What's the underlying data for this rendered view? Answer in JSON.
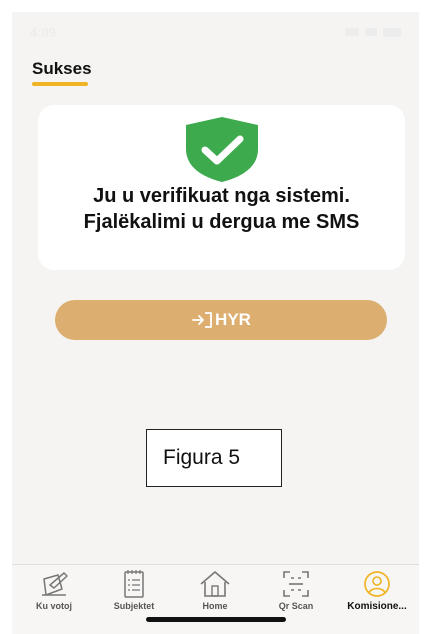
{
  "status_bar": {
    "time": "4:09"
  },
  "header": {
    "title": "Sukses"
  },
  "card": {
    "message": "Ju u verifikuat nga sistemi. Fjalëkalimi u dergua me SMS"
  },
  "login_button": {
    "label": "HYR"
  },
  "figure_caption": "Figura 5",
  "tabbar": {
    "items": [
      {
        "label": "Ku votoj",
        "icon": "vote-icon"
      },
      {
        "label": "Subjektet",
        "icon": "list-icon"
      },
      {
        "label": "Home",
        "icon": "home-icon"
      },
      {
        "label": "Qr Scan",
        "icon": "qr-scan-icon"
      },
      {
        "label": "Komisione...",
        "icon": "user-icon",
        "active": true
      }
    ]
  },
  "colors": {
    "accent_underline": "#f0b323",
    "button": "#dcae70",
    "shield": "#3daa4e",
    "active_tab": "#f0b323"
  }
}
